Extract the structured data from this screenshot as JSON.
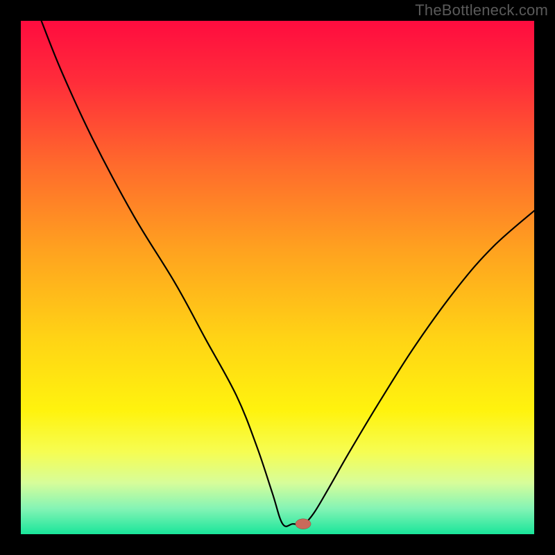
{
  "watermark": "TheBottleneck.com",
  "chart_data": {
    "type": "line",
    "title": "",
    "xlabel": "",
    "ylabel": "",
    "xlim": [
      0,
      100
    ],
    "ylim": [
      0,
      100
    ],
    "background": {
      "type": "vertical-gradient",
      "stops": [
        {
          "offset": 0.0,
          "color": "#ff0c3f"
        },
        {
          "offset": 0.12,
          "color": "#ff2d3a"
        },
        {
          "offset": 0.28,
          "color": "#ff6a2c"
        },
        {
          "offset": 0.45,
          "color": "#ffa31f"
        },
        {
          "offset": 0.62,
          "color": "#ffd415"
        },
        {
          "offset": 0.76,
          "color": "#fff30e"
        },
        {
          "offset": 0.84,
          "color": "#f6fd52"
        },
        {
          "offset": 0.9,
          "color": "#d7fd9a"
        },
        {
          "offset": 0.95,
          "color": "#84f4b5"
        },
        {
          "offset": 1.0,
          "color": "#19e59a"
        }
      ]
    },
    "curve": {
      "stroke": "#000000",
      "stroke_width": 2.2,
      "points": [
        {
          "x": 4.0,
          "y": 100.0
        },
        {
          "x": 8.0,
          "y": 90.0
        },
        {
          "x": 14.0,
          "y": 77.0
        },
        {
          "x": 22.0,
          "y": 62.0
        },
        {
          "x": 30.0,
          "y": 49.0
        },
        {
          "x": 36.0,
          "y": 38.0
        },
        {
          "x": 42.0,
          "y": 27.0
        },
        {
          "x": 46.0,
          "y": 17.0
        },
        {
          "x": 49.0,
          "y": 8.0
        },
        {
          "x": 51.0,
          "y": 2.0
        },
        {
          "x": 53.0,
          "y": 2.0
        },
        {
          "x": 55.0,
          "y": 2.0
        },
        {
          "x": 57.0,
          "y": 4.0
        },
        {
          "x": 60.0,
          "y": 9.0
        },
        {
          "x": 64.0,
          "y": 16.0
        },
        {
          "x": 70.0,
          "y": 26.0
        },
        {
          "x": 77.0,
          "y": 37.0
        },
        {
          "x": 85.0,
          "y": 48.0
        },
        {
          "x": 92.0,
          "y": 56.0
        },
        {
          "x": 100.0,
          "y": 63.0
        }
      ]
    },
    "marker": {
      "x": 55.0,
      "y": 2.0,
      "rx": 1.5,
      "ry": 1.0,
      "fill": "#c96a5a",
      "stroke": "#7a3a30"
    }
  }
}
